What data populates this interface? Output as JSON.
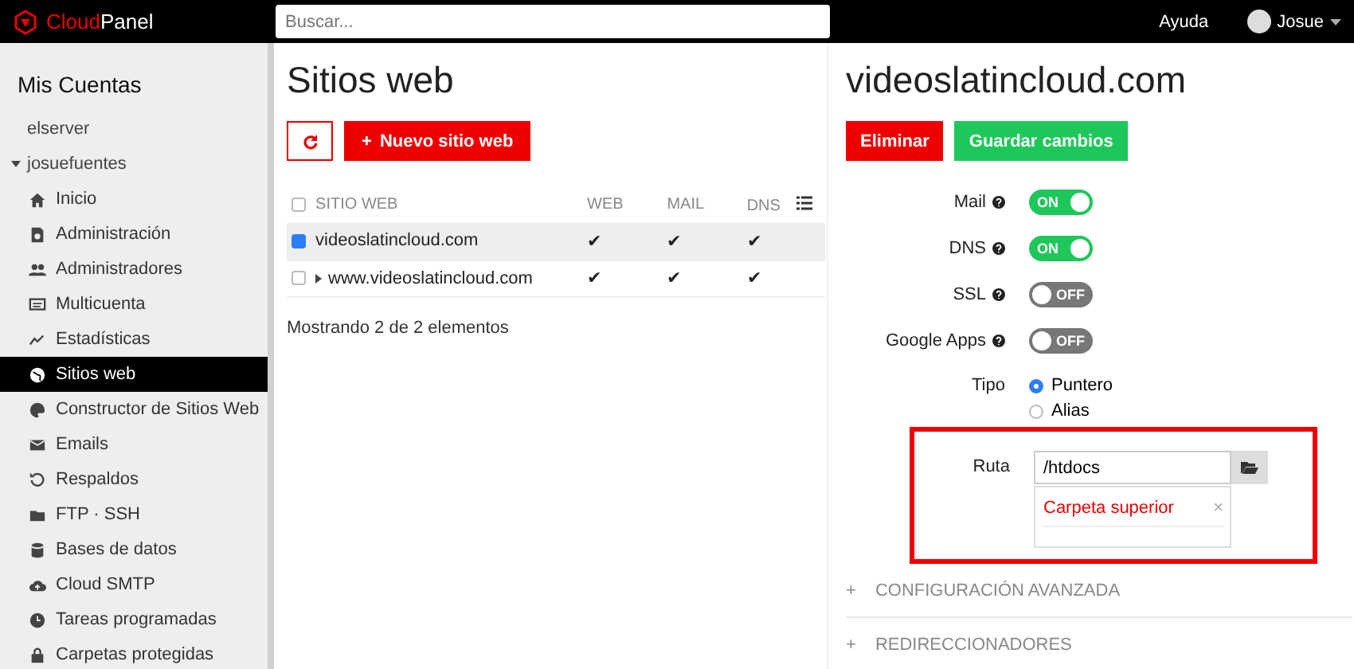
{
  "topbar": {
    "logo": {
      "accent": "Cloud",
      "text": "Panel"
    },
    "search": {
      "placeholder": "Buscar..."
    },
    "help": "Ayuda",
    "user": "Josue"
  },
  "sidebar": {
    "title": "Mis Cuentas",
    "accounts": [
      {
        "name": "elserver",
        "expanded": false
      },
      {
        "name": "josuefuentes",
        "expanded": true,
        "children": [
          {
            "label": "Inicio",
            "selected": false
          },
          {
            "label": "Administración",
            "selected": false
          },
          {
            "label": "Administradores",
            "selected": false
          },
          {
            "label": "Multicuenta",
            "selected": false
          },
          {
            "label": "Estadísticas",
            "selected": false
          },
          {
            "label": "Sitios web",
            "selected": true
          },
          {
            "label": "Constructor de Sitios Web",
            "selected": false
          },
          {
            "label": "Emails",
            "selected": false
          },
          {
            "label": "Respaldos",
            "selected": false
          },
          {
            "label": "FTP · SSH",
            "selected": false
          },
          {
            "label": "Bases de datos",
            "selected": false
          },
          {
            "label": "Cloud SMTP",
            "selected": false
          },
          {
            "label": "Tareas programadas",
            "selected": false
          },
          {
            "label": "Carpetas protegidas",
            "selected": false
          }
        ]
      }
    ]
  },
  "sites": {
    "title": "Sitios web",
    "new_button": "Nuevo sitio web",
    "new_button_mark": "+",
    "table": {
      "all_checked": false,
      "columns": [
        "SITIO WEB",
        "WEB",
        "MAIL",
        "DNS"
      ],
      "rows": [
        {
          "kind": "main",
          "checked": true,
          "selected": true,
          "cells": [
            "videoslatincloud.com",
            "✔",
            "✔",
            "✔"
          ]
        },
        {
          "kind": "alias",
          "checked": false,
          "selected": false,
          "cells": [
            "www.videoslatincloud.com",
            "✔",
            "✔",
            "✔"
          ]
        }
      ]
    },
    "footer": "Mostrando 2 de 2 elementos"
  },
  "detail": {
    "title": "videoslatincloud.com",
    "buttons": [
      {
        "label": "Eliminar",
        "kind": "danger"
      },
      {
        "label": "Guardar cambios",
        "kind": "success"
      }
    ],
    "toggles": [
      {
        "label": "Mail",
        "on": true,
        "text": "ON"
      },
      {
        "label": "DNS",
        "on": true,
        "text": "ON"
      },
      {
        "label": "SSL",
        "on": false,
        "text": "OFF"
      },
      {
        "label": "Google Apps",
        "on": false,
        "text": "OFF"
      }
    ],
    "type": {
      "label": "Tipo",
      "options": [
        {
          "label": "Puntero",
          "selected": true
        },
        {
          "label": "Alias",
          "selected": false
        }
      ]
    },
    "path": {
      "label": "Ruta",
      "value": "/htdocs",
      "highlighted": true,
      "suggestions": [
        "Carpeta superior"
      ],
      "close": "×"
    },
    "sections": [
      {
        "mark": "+",
        "label": "CONFIGURACIÓN AVANZADA",
        "expanded": false
      },
      {
        "mark": "+",
        "label": "REDIRECCIONADORES",
        "expanded": false
      }
    ]
  }
}
